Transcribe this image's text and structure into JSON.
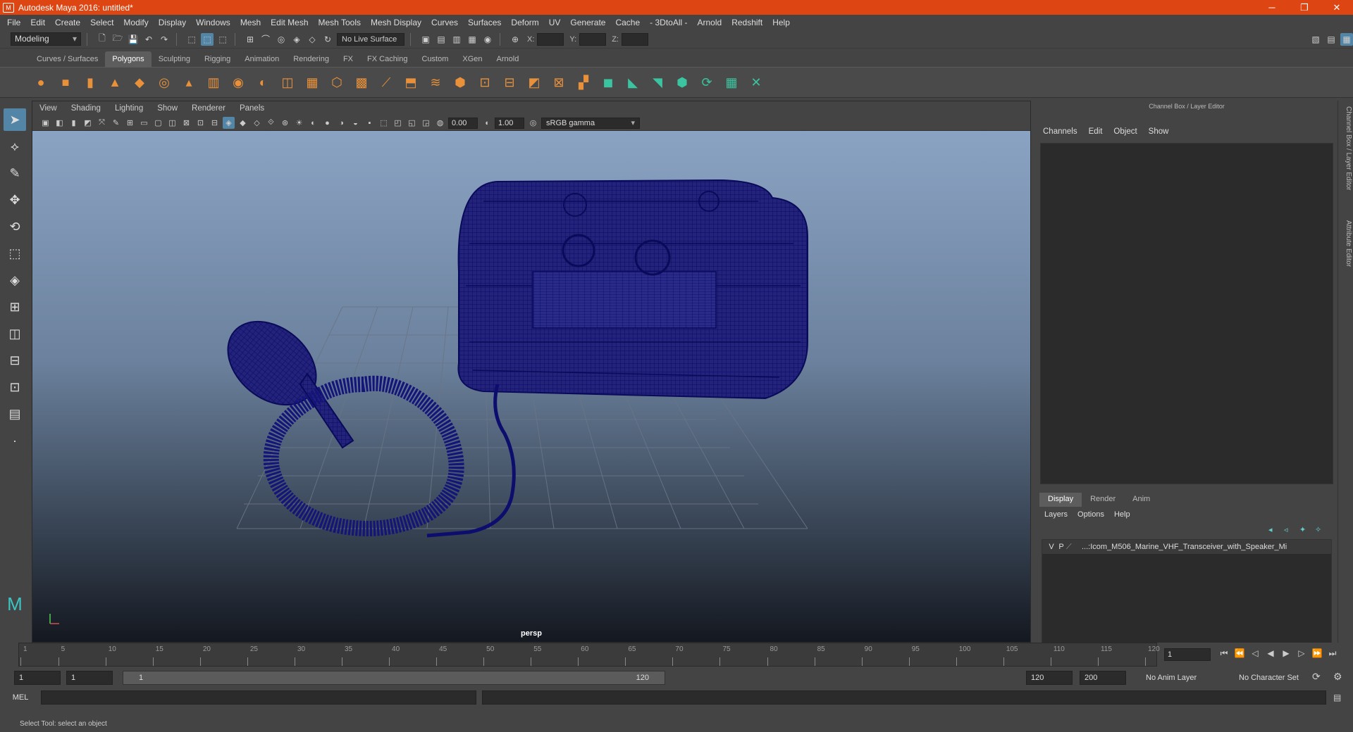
{
  "window": {
    "title": "Autodesk Maya 2016: untitled*",
    "minimize": "─",
    "restore": "❐",
    "close": "✕"
  },
  "menubar": [
    "File",
    "Edit",
    "Create",
    "Select",
    "Modify",
    "Display",
    "Windows",
    "Mesh",
    "Edit Mesh",
    "Mesh Tools",
    "Mesh Display",
    "Curves",
    "Surfaces",
    "Deform",
    "UV",
    "Generate",
    "Cache",
    "- 3DtoAll -",
    "Arnold",
    "Redshift",
    "Help"
  ],
  "status_line": {
    "mode": "Modeling",
    "live_surface": "No Live Surface",
    "x_label": "X:",
    "y_label": "Y:",
    "z_label": "Z:"
  },
  "shelf_tabs": [
    "Curves / Surfaces",
    "Polygons",
    "Sculpting",
    "Rigging",
    "Animation",
    "Rendering",
    "FX",
    "FX Caching",
    "Custom",
    "XGen",
    "Arnold"
  ],
  "shelf_active": "Polygons",
  "viewport": {
    "menu": [
      "View",
      "Shading",
      "Lighting",
      "Show",
      "Renderer",
      "Panels"
    ],
    "exposure": "0.00",
    "gamma": "1.00",
    "colorspace": "sRGB gamma",
    "camera": "persp"
  },
  "channel_box": {
    "title": "Channel Box / Layer Editor",
    "menu": [
      "Channels",
      "Edit",
      "Object",
      "Show"
    ]
  },
  "layer_editor": {
    "tabs": [
      "Display",
      "Render",
      "Anim"
    ],
    "active_tab": "Display",
    "menu": [
      "Layers",
      "Options",
      "Help"
    ],
    "layer": {
      "v": "V",
      "p": "P",
      "name": "...:Icom_M506_Marine_VHF_Transceiver_with_Speaker_Mi"
    }
  },
  "side_tabs": [
    "Channel Box / Layer Editor",
    "Attribute Editor"
  ],
  "timeline": {
    "ticks": [
      "1",
      "5",
      "10",
      "15",
      "20",
      "25",
      "30",
      "35",
      "40",
      "45",
      "50",
      "55",
      "60",
      "65",
      "70",
      "75",
      "80",
      "85",
      "90",
      "95",
      "100",
      "105",
      "110",
      "115",
      "120"
    ],
    "current_frame": "1"
  },
  "range": {
    "start": "1",
    "playback_start": "1",
    "range_start": "1",
    "range_end": "120",
    "playback_end": "120",
    "end": "200",
    "anim_layer": "No Anim Layer",
    "character_set": "No Character Set"
  },
  "command": {
    "label": "MEL"
  },
  "help_line": "Select Tool: select an object",
  "colors": {
    "title_bar": "#dd4613",
    "selection": "#5285a6",
    "wireframe": "#0d0d6e"
  }
}
